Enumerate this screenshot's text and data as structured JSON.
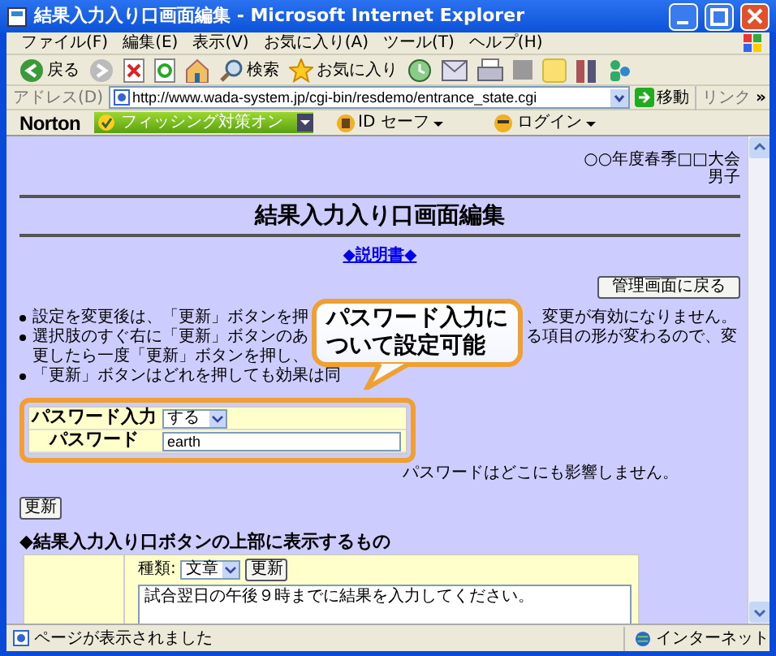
{
  "window": {
    "title": "結果入力入り口画面編集 - Microsoft Internet Explorer"
  },
  "menu": [
    "ファイル(F)",
    "編集(E)",
    "表示(V)",
    "お気に入り(A)",
    "ツール(T)",
    "ヘルプ(H)"
  ],
  "toolbar": {
    "back": "戻る",
    "search": "検索",
    "favorites": "お気に入り"
  },
  "address": {
    "label": "アドレス(D)",
    "url": "http://www.wada-system.jp/cgi-bin/resdemo/entrance_state.cgi",
    "go": "移動",
    "links": "リンク",
    "more": "»"
  },
  "norton": {
    "logo": "Norton",
    "phishing": "フィッシング対策オン",
    "id_safe": "ID セーフ",
    "login": "ログイン"
  },
  "page": {
    "header": [
      "○○年度春季□□大会",
      "男子"
    ],
    "heading": "結果入力入り口画面編集",
    "manual_link": "◆説明書◆",
    "back_button": "管理画面に戻る",
    "bullets": [
      {
        "parts": [
          "設定を変更後は、「更新」ボタンを押",
          "、変更が有効になりません。"
        ]
      },
      {
        "parts": [
          "選択肢のすぐ右に「更新」ボタンのあ",
          "る項目の形が変わるので、変"
        ],
        "continuation": "更したら一度「更新」ボタンを押し、"
      },
      {
        "parts": [
          "「更新」ボタンはどれを押しても効果は同"
        ]
      }
    ],
    "settings": [
      {
        "label": "パスワード入力",
        "kind": "select",
        "value": "する"
      },
      {
        "label": "パスワード",
        "kind": "text",
        "value": "earth"
      }
    ],
    "note": "パスワードはどこにも影響しません。",
    "update_button": "更新",
    "section_heading": "◆結果入力入り口ボタンの上部に表示するもの",
    "section": {
      "type_label": "種類:",
      "type_value": "文章",
      "update_button": "更新",
      "text": "試合翌日の午後９時までに結果を入力してください。"
    }
  },
  "callout": {
    "lines": [
      "パスワード入力に",
      "ついて設定可能"
    ]
  },
  "status_bar": {
    "text": "ページが表示されました",
    "zone": "インターネット"
  }
}
